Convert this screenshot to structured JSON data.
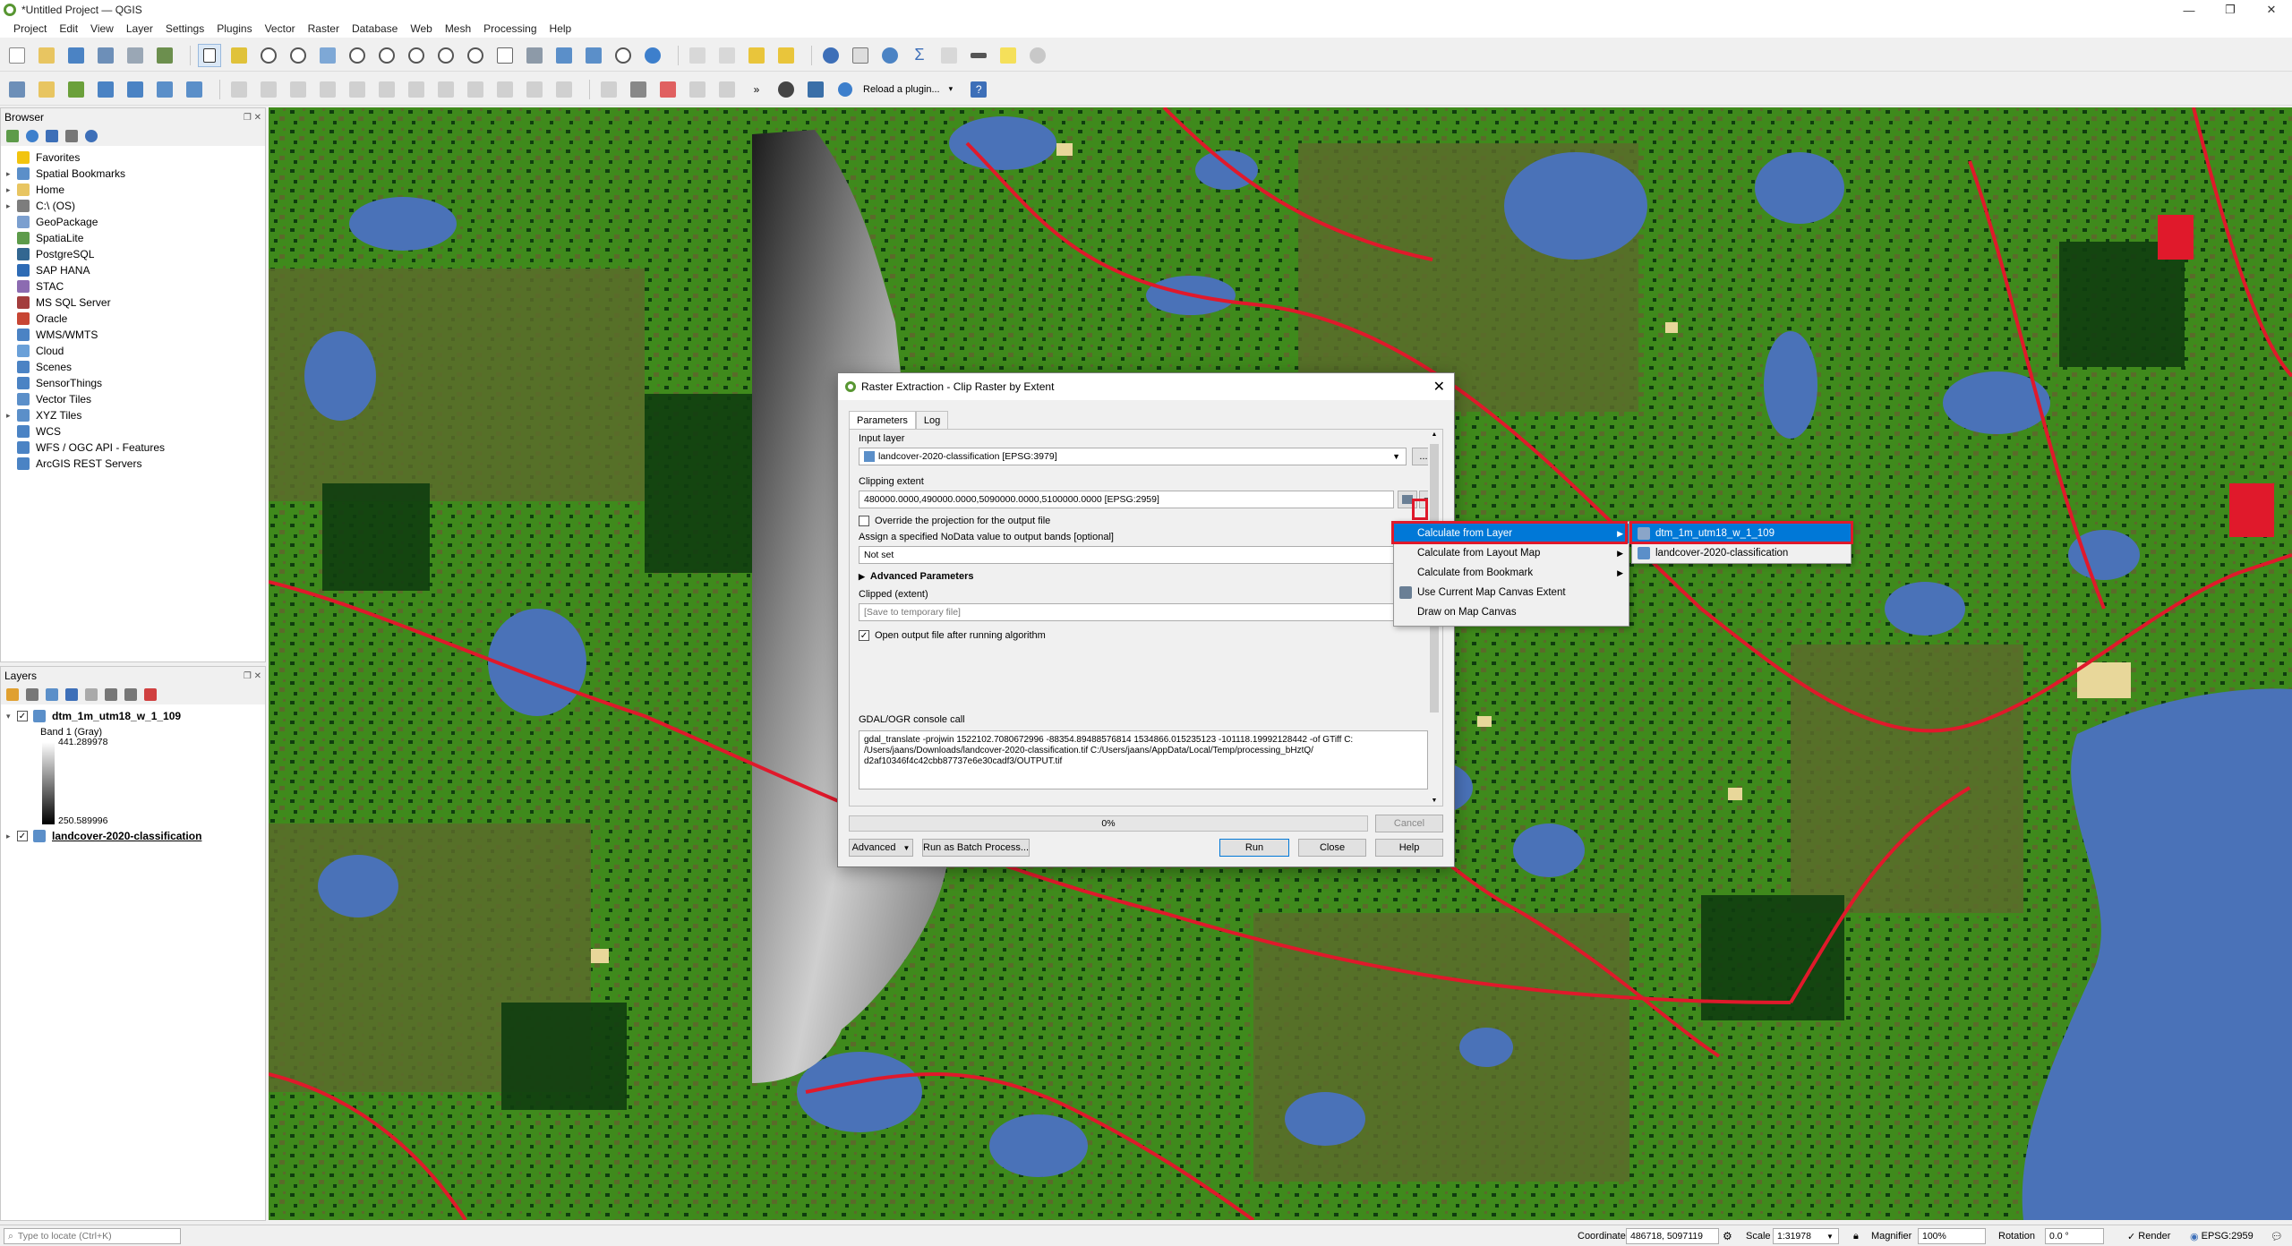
{
  "window": {
    "title": "*Untitled Project — QGIS",
    "minimize": "—",
    "maximize": "❐",
    "close": "✕"
  },
  "menubar": [
    "Project",
    "Edit",
    "View",
    "Layer",
    "Settings",
    "Plugins",
    "Vector",
    "Raster",
    "Database",
    "Web",
    "Mesh",
    "Processing",
    "Help"
  ],
  "toolbar2": {
    "reload_label": "Reload a plugin..."
  },
  "browser": {
    "title": "Browser",
    "items": [
      {
        "label": "Favorites",
        "icon": "star-icon",
        "color": "#f2c40f",
        "expand": ""
      },
      {
        "label": "Spatial Bookmarks",
        "icon": "bookmark-icon",
        "color": "#5b8fc9",
        "expand": "▸"
      },
      {
        "label": "Home",
        "icon": "folder-icon",
        "color": "#e8c561",
        "expand": "▸"
      },
      {
        "label": "C:\\ (OS)",
        "icon": "drive-icon",
        "color": "#7d7d7d",
        "expand": "▸"
      },
      {
        "label": "GeoPackage",
        "icon": "geopackage-icon",
        "color": "#7b9fcf",
        "expand": ""
      },
      {
        "label": "SpatiaLite",
        "icon": "spatialite-icon",
        "color": "#5d9b4a",
        "expand": ""
      },
      {
        "label": "PostgreSQL",
        "icon": "postgresql-icon",
        "color": "#336791",
        "expand": ""
      },
      {
        "label": "SAP HANA",
        "icon": "sap-hana-icon",
        "color": "#2e6bb5",
        "expand": ""
      },
      {
        "label": "STAC",
        "icon": "stac-icon",
        "color": "#8c6bb1",
        "expand": ""
      },
      {
        "label": "MS SQL Server",
        "icon": "mssql-icon",
        "color": "#a33d3d",
        "expand": ""
      },
      {
        "label": "Oracle",
        "icon": "oracle-icon",
        "color": "#c74634",
        "expand": ""
      },
      {
        "label": "WMS/WMTS",
        "icon": "wms-icon",
        "color": "#4b83c4",
        "expand": ""
      },
      {
        "label": "Cloud",
        "icon": "cloud-icon",
        "color": "#6aa0d8",
        "expand": ""
      },
      {
        "label": "Scenes",
        "icon": "scenes-icon",
        "color": "#4b83c4",
        "expand": ""
      },
      {
        "label": "SensorThings",
        "icon": "sensorthings-icon",
        "color": "#4b83c4",
        "expand": ""
      },
      {
        "label": "Vector Tiles",
        "icon": "vector-tiles-icon",
        "color": "#5b8fc9",
        "expand": ""
      },
      {
        "label": "XYZ Tiles",
        "icon": "xyz-tiles-icon",
        "color": "#5b8fc9",
        "expand": "▸"
      },
      {
        "label": "WCS",
        "icon": "wcs-icon",
        "color": "#4b83c4",
        "expand": ""
      },
      {
        "label": "WFS / OGC API - Features",
        "icon": "wfs-icon",
        "color": "#4b83c4",
        "expand": ""
      },
      {
        "label": "ArcGIS REST Servers",
        "icon": "arcgis-icon",
        "color": "#4b83c4",
        "expand": ""
      }
    ]
  },
  "layers": {
    "title": "Layers",
    "layer1": {
      "name": "dtm_1m_utm18_w_1_109",
      "band": "Band 1 (Gray)",
      "max": "441.289978",
      "min": "250.589996"
    },
    "layer2": {
      "name": "landcover-2020-classification"
    }
  },
  "dialog": {
    "title": "Raster Extraction - Clip Raster by Extent",
    "tabs": [
      "Parameters",
      "Log"
    ],
    "input_layer_label": "Input layer",
    "input_layer_value": "landcover-2020-classification [EPSG:3979]",
    "clipping_extent_label": "Clipping extent",
    "clipping_extent_value": "480000.0000,490000.0000,5090000.0000,5100000.0000 [EPSG:2959]",
    "override_label": "Override the projection for the output file",
    "nodata_label": "Assign a specified NoData value to output bands [optional]",
    "nodata_value": "Not set",
    "advanced_label": "Advanced Parameters",
    "clipped_label": "Clipped (extent)",
    "clipped_placeholder": "[Save to temporary file]",
    "open_output_label": "Open output file after running algorithm",
    "console_label": "GDAL/OGR console call",
    "console_text": "gdal_translate -projwin 1522102.7080672996 -88354.89488576814 1534866.015235123 -101118.19992128442 -of GTiff C:\n/Users/jaans/Downloads/landcover-2020-classification.tif C:/Users/jaans/AppData/Local/Temp/processing_bHztQ/\nd2af10346f4c42cbb87737e6e30cadf3/OUTPUT.tif",
    "progress": "0%",
    "progress_fraction": 0,
    "cancel": "Cancel",
    "advanced_btn": "Advanced",
    "batch_btn": "Run as Batch Process...",
    "run": "Run",
    "close": "Close",
    "help": "Help",
    "browse": "..."
  },
  "extent_menu": {
    "items": [
      {
        "label": "Calculate from Layer",
        "submenu": true,
        "selected": true
      },
      {
        "label": "Calculate from Layout Map",
        "submenu": true,
        "selected": false
      },
      {
        "label": "Calculate from Bookmark",
        "submenu": true,
        "selected": false
      },
      {
        "label": "Use Current Map Canvas Extent",
        "submenu": false,
        "selected": false
      },
      {
        "label": "Draw on Map Canvas",
        "submenu": false,
        "selected": false
      }
    ]
  },
  "layer_submenu": {
    "items": [
      "dtm_1m_utm18_w_1_109",
      "landcover-2020-classification"
    ]
  },
  "statusbar": {
    "locate_placeholder": "Type to locate (Ctrl+K)",
    "coordinate_label": "Coordinate",
    "coordinate_value": "486718, 5097119",
    "scale_label": "Scale",
    "scale_value": "1:31978",
    "magnifier_label": "Magnifier",
    "magnifier_value": "100%",
    "rotation_label": "Rotation",
    "rotation_value": "0.0 °",
    "render_label": "Render",
    "crs": "EPSG:2959"
  },
  "colors": {
    "forest": "#3f8a1c",
    "dark_forest": "#0f3d0f",
    "wetland": "#5a6b2a",
    "water": "#4a72b8",
    "road": "#e0192b",
    "urban": "#e8d79a",
    "accent": "#0078d7"
  }
}
